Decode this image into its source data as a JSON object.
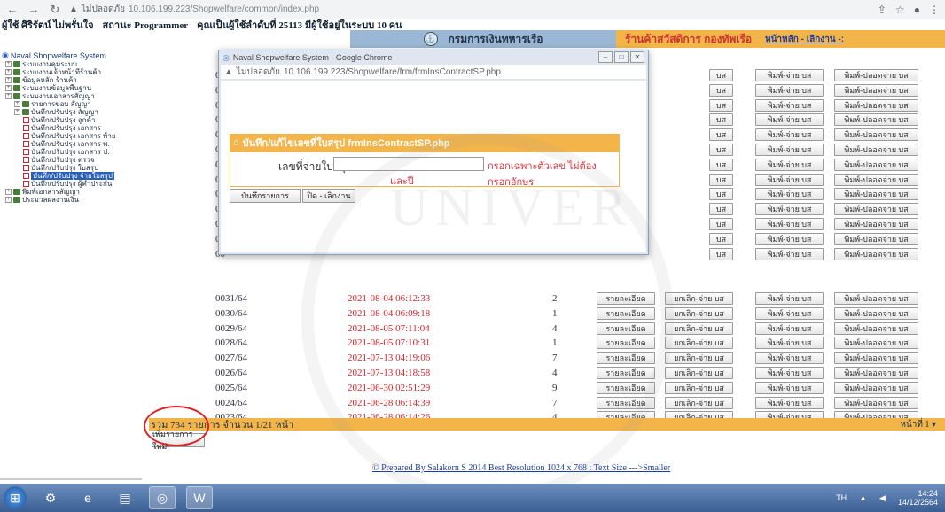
{
  "browser": {
    "warn": "ไม่ปลอดภัย",
    "url": "10.106.199.223/Shopwelfare/common/index.php"
  },
  "userbar": {
    "user": "ผู้ใช้ ศิริรัตน์  ไม่พรั่นใจ",
    "status": "สถานะ Programmer",
    "online": "คุณเป็นผู้ใช้ลำดับที่ 25113  มีผู้ใช้อยู่ในระบบ 10 คน"
  },
  "header": {
    "dept": "กรมการเงินทหารเรือ",
    "shop": "ร้านค้าสวัสดิการ กองทัพเรือ",
    "logout": "หน้าหลัก - เลิกงาน -:"
  },
  "sidebar": {
    "root": "Naval Shopwelfare System",
    "items": [
      {
        "label": "ระบบงานคุมระบบ",
        "level": 1
      },
      {
        "label": "ระบบงานเจ้าหน้าที่ร้านค้า",
        "level": 1
      },
      {
        "label": "ข้อมูลหลัก ร้านค้า",
        "level": 1
      },
      {
        "label": "ระบบงานข้อมูลพื้นฐาน",
        "level": 1
      },
      {
        "label": "ระบบงานเอกสารสัญญา",
        "level": 1
      },
      {
        "label": "รายการขอบ สัญญา",
        "level": 2
      },
      {
        "label": "บันทึก/ปรับปรุง สัญญา",
        "level": 2
      },
      {
        "label": "บันทึก/ปรับปรุง ลูกค้า",
        "level": 3
      },
      {
        "label": "บันทึก/ปรับปรุง เอกสาร",
        "level": 3
      },
      {
        "label": "บันทึก/ปรับปรุง เอกสาร ท้าย",
        "level": 3
      },
      {
        "label": "บันทึก/ปรับปรุง เอกสาร พ.",
        "level": 3
      },
      {
        "label": "บันทึก/ปรับปรุง เอกสาร ป.",
        "level": 3
      },
      {
        "label": "บันทึก/ปรับปรุง ตรวจ",
        "level": 3
      },
      {
        "label": "บันทึก/ปรับปรุง ใบสรุป",
        "level": 3
      },
      {
        "label": "บันทึก/ปรับปรุง จ่ายใบสรุป",
        "level": 3,
        "selected": true
      },
      {
        "label": "บันทึก/ปรับปรุง ผู้ค้ำประกัน",
        "level": 3
      },
      {
        "label": "พิมพ์เอกสารสัญญา",
        "level": 1
      },
      {
        "label": "ประมวลผลงานเงิน",
        "level": 1
      }
    ]
  },
  "table": {
    "buttons": {
      "detail": "รายละเอียด",
      "cancel": "ยกเลิก-จ่าย บส",
      "print": "พิมพ์-จ่าย บส",
      "print_release": "พิมพ์-ปลอดจ่าย บส"
    },
    "hidden_rows_prefix": [
      "00",
      "00",
      "00",
      "00",
      "00",
      "00",
      "00",
      "00",
      "00",
      "00",
      "00",
      "00",
      "00"
    ],
    "partial_btn": "บส",
    "rows": [
      {
        "id": "0031/64",
        "date": "2021-08-04 06:12:33",
        "qty": "2"
      },
      {
        "id": "0030/64",
        "date": "2021-08-04 06:09:18",
        "qty": "1"
      },
      {
        "id": "0029/64",
        "date": "2021-08-05 07:11:04",
        "qty": "4"
      },
      {
        "id": "0028/64",
        "date": "2021-08-05 07:10:31",
        "qty": "1"
      },
      {
        "id": "0027/64",
        "date": "2021-07-13 04:19:06",
        "qty": "7"
      },
      {
        "id": "0026/64",
        "date": "2021-07-13 04:18:58",
        "qty": "4"
      },
      {
        "id": "0025/64",
        "date": "2021-06-30 02:51:29",
        "qty": "9"
      },
      {
        "id": "0024/64",
        "date": "2021-06-28 06:14:39",
        "qty": "7"
      },
      {
        "id": "0023/64",
        "date": "2021-06-28 06:14:26",
        "qty": "4"
      }
    ]
  },
  "summary": {
    "text": "รวม 734 รายการ จำนวน 1/21 หน้า",
    "page": "หน้าที่ 1"
  },
  "add_button": "เพิ่มรายการใหม่",
  "footer": "© Prepared By Salakorn S 2014 Best Resolution 1024 x 768 : Text Size --->Smaller",
  "popup": {
    "title": "Naval Shopwelfare System - Google Chrome",
    "warn": "ไม่ปลอดภัย",
    "url": "10.106.199.223/Shopwelfare/frm/frmInsContractSP.php",
    "form_title": "บันทึก/แก้ไขเลขที่ใบสรุป frmInsContractSP.php",
    "field_label": "เลขที่จ่ายใบสรุป",
    "field_value": "",
    "hint": "กรอกเฉพาะตัวเลข ไม่ต้องกรอกอักษร",
    "hint2": "และปี",
    "save": "บันทึกรายการ",
    "close": "ปิด - เลิกงาน"
  },
  "taskbar": {
    "time": "14:24",
    "date": "14/12/2564",
    "lang": "TH"
  }
}
